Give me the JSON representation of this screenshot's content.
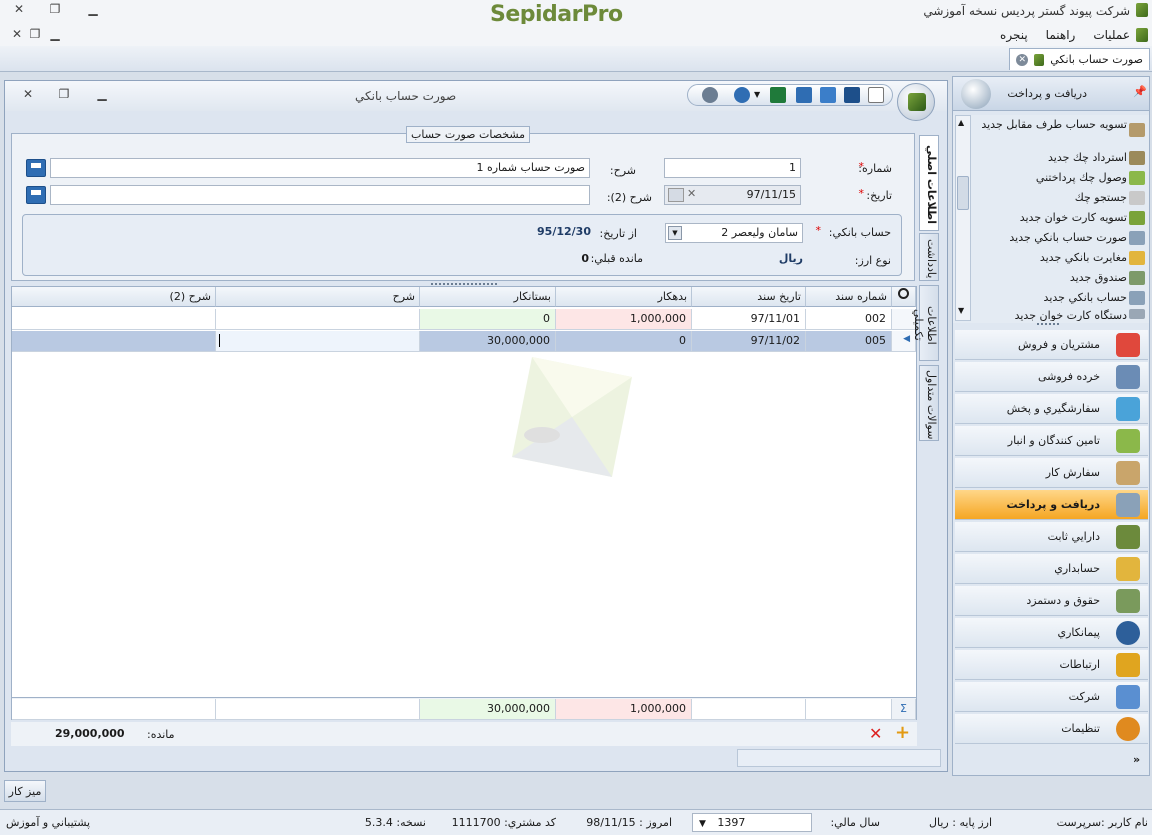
{
  "app": {
    "title": "شرکت پیوند گستر پردیس نسخه آموزشي",
    "logo": "SepidarPro"
  },
  "menu": {
    "items": [
      "عملیات",
      "راهنما",
      "پنجره"
    ]
  },
  "doc_tab": {
    "label": "صورت حساب بانکي"
  },
  "nav": {
    "header": "دريافت و پرداخت",
    "tasks": [
      {
        "label": "تسویه حساب طرف مقابل جديد",
        "icon": "settle-icon"
      },
      {
        "label": "استرداد چك جديد",
        "icon": "cheque-return-icon"
      },
      {
        "label": "وصول چك پرداختني",
        "icon": "cheque-collect-icon"
      },
      {
        "label": "جستجو چك",
        "icon": "cheque-search-icon"
      },
      {
        "label": "تسويه کارت خوان جديد",
        "icon": "card-reader-icon"
      },
      {
        "label": "صورت حساب بانکي جديد",
        "icon": "bank-statement-icon"
      },
      {
        "label": "مغايرت بانكي جديد",
        "icon": "reconcile-icon"
      },
      {
        "label": "صندوق جديد",
        "icon": "cashbox-icon"
      },
      {
        "label": "حساب بانکي جديد",
        "icon": "bank-account-icon"
      },
      {
        "label": "دستگاه کارت خوان جديد",
        "icon": "card-device-icon"
      }
    ],
    "modules": [
      {
        "label": "مشتريان و فروش",
        "color": "#e0483c"
      },
      {
        "label": "خرده فروشی",
        "color": "#6b8cb5"
      },
      {
        "label": "سفارشگيري و پخش",
        "color": "#4aa3d9"
      },
      {
        "label": "تامين کنندگان و انبار",
        "color": "#8bb84a"
      },
      {
        "label": "سفارش کار",
        "color": "#c9a56b"
      },
      {
        "label": "دريافت و پرداخت",
        "color": "#8aa1b8"
      },
      {
        "label": "دارايي ثابت",
        "color": "#6c8a3c"
      },
      {
        "label": "حسابداري",
        "color": "#e2b53d"
      },
      {
        "label": "حقوق و دستمزد",
        "color": "#7a9a5c"
      },
      {
        "label": "پيمانکاري",
        "color": "#2d5f9a"
      },
      {
        "label": "ارتباطات",
        "color": "#e0a51f"
      },
      {
        "label": "شرکت",
        "color": "#5a8fd1"
      },
      {
        "label": "تنظيمات",
        "color": "#e08a1f"
      }
    ],
    "active_module_index": 5
  },
  "window": {
    "title": "صورت حساب بانکي",
    "group_title": "مشخصات صورت حساب",
    "fields": {
      "number_label": "شماره:",
      "number_value": "1",
      "date_label": "تاريخ:",
      "date_value": "97/11/15",
      "desc_label": "شرح:",
      "desc_value": "صورت حساب شماره 1",
      "desc2_label": "شرح (2):",
      "desc2_value": "",
      "bank_label": "حساب بانکي:",
      "bank_value": "سامان وليعصر 2",
      "from_date_label": "از تاريخ:",
      "from_date_value": "95/12/30",
      "currency_label": "نوع ارز:",
      "currency_value": "ريال",
      "prev_balance_label": "مانده قبلي:",
      "prev_balance_value": "0"
    },
    "vtabs": [
      "اطلاعات اصلي",
      "يادداشت",
      "اطلاعات تکميلي",
      "سوالات متداول"
    ]
  },
  "grid": {
    "columns": [
      "شماره سند",
      "تاريخ سند",
      "بدهکار",
      "بستانکار",
      "شرح",
      "شرح (2)"
    ],
    "rows": [
      [
        "002",
        "97/11/01",
        "1,000,000",
        "0",
        "",
        ""
      ],
      [
        "005",
        "97/11/02",
        "0",
        "30,000,000",
        "",
        ""
      ]
    ],
    "totals": {
      "debit": "1,000,000",
      "credit": "30,000,000"
    },
    "balance_label": "مانده:",
    "balance_value": "29,000,000"
  },
  "desktop": {
    "label": "ميز کار"
  },
  "status": {
    "user": "نام کاربر :سرپرست",
    "base_currency": "ارز پايه :   ريال",
    "fiscal_year_label": "سال مالي:",
    "fiscal_year_value": "1397",
    "today": "امروز :   98/11/15",
    "customer_code": "کد مشتري:   1111700",
    "version": "نسخه:   5.3.4",
    "support": "پشتيباني و آموزش"
  }
}
